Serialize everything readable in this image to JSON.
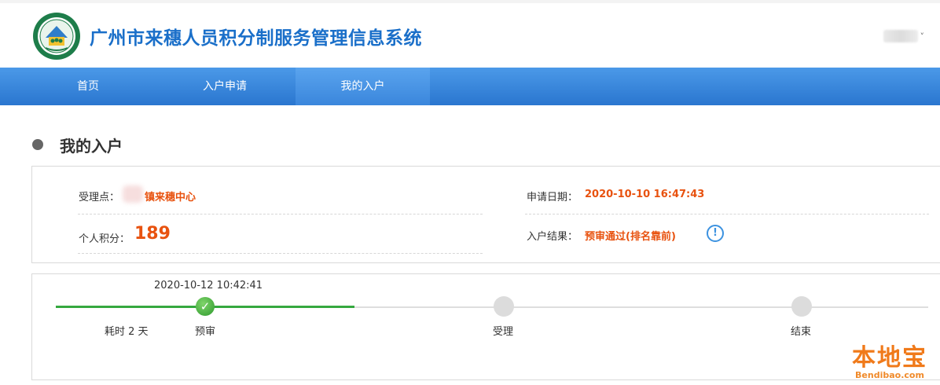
{
  "header": {
    "title": "广州市来穗人员积分制服务管理信息系统",
    "logo_name": "guangzhou-emblem",
    "user_menu_caret": "˅"
  },
  "nav": {
    "items": [
      {
        "label": "首页"
      },
      {
        "label": "入户申请"
      },
      {
        "label": "我的入户",
        "active": true
      }
    ]
  },
  "section": {
    "title": "我的入户"
  },
  "info": {
    "acceptance_label": "受理点：",
    "acceptance_value": "镇来穗中心",
    "score_label": "个人积分：",
    "score_value": "189",
    "apply_date_label": "申请日期：",
    "apply_date_value": "2020-10-10 16:47:43",
    "result_label": "入户结果：",
    "result_value": "预审通过(排名靠前)",
    "info_icon": "!"
  },
  "progress": {
    "completed_time": "2020-10-12 10:42:41",
    "duration": "耗时 2 天",
    "steps": [
      {
        "label": "预审",
        "done": true
      },
      {
        "label": "受理",
        "done": false
      },
      {
        "label": "结束",
        "done": false
      }
    ],
    "check_glyph": "✓"
  },
  "watermark": {
    "text": "本地宝",
    "sub": "Bendibao.com"
  },
  "colors": {
    "brand_blue": "#1a6fc9",
    "nav_blue": "#2a76cf",
    "accent_orange": "#e8520f",
    "done_green": "#35a83f"
  }
}
